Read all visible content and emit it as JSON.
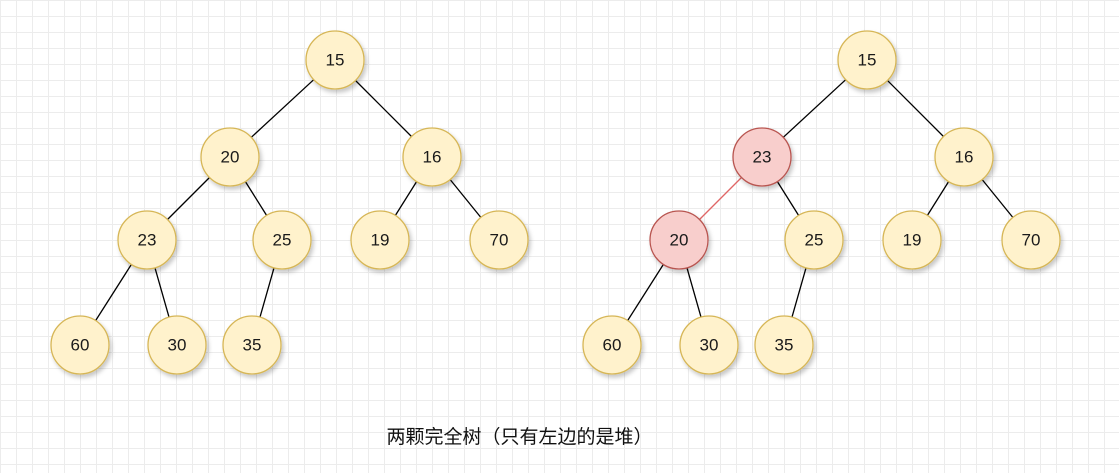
{
  "caption": "两颗完全树（只有左边的是堆）",
  "colors": {
    "node_fill": "#fff2cc",
    "node_stroke": "#d6b656",
    "highlight_fill": "#f8cecc",
    "highlight_stroke": "#b85450",
    "edge": "#000000",
    "highlight_edge": "#e06666"
  },
  "trees": [
    {
      "name": "left-tree",
      "nodes": [
        {
          "id": "n1",
          "label": "15"
        },
        {
          "id": "n2",
          "label": "20"
        },
        {
          "id": "n3",
          "label": "16"
        },
        {
          "id": "n4",
          "label": "23"
        },
        {
          "id": "n5",
          "label": "25"
        },
        {
          "id": "n6",
          "label": "19"
        },
        {
          "id": "n7",
          "label": "70"
        },
        {
          "id": "n8",
          "label": "60"
        },
        {
          "id": "n9",
          "label": "30"
        },
        {
          "id": "n10",
          "label": "35"
        }
      ],
      "edges": [
        [
          "n1",
          "n2"
        ],
        [
          "n1",
          "n3"
        ],
        [
          "n2",
          "n4"
        ],
        [
          "n2",
          "n5"
        ],
        [
          "n3",
          "n6"
        ],
        [
          "n3",
          "n7"
        ],
        [
          "n4",
          "n8"
        ],
        [
          "n4",
          "n9"
        ],
        [
          "n5",
          "n10"
        ]
      ]
    },
    {
      "name": "right-tree",
      "nodes": [
        {
          "id": "m1",
          "label": "15"
        },
        {
          "id": "m2",
          "label": "23",
          "highlight": true
        },
        {
          "id": "m3",
          "label": "16"
        },
        {
          "id": "m4",
          "label": "20",
          "highlight": true
        },
        {
          "id": "m5",
          "label": "25"
        },
        {
          "id": "m6",
          "label": "19"
        },
        {
          "id": "m7",
          "label": "70"
        },
        {
          "id": "m8",
          "label": "60"
        },
        {
          "id": "m9",
          "label": "30"
        },
        {
          "id": "m10",
          "label": "35"
        }
      ],
      "edges": [
        [
          "m1",
          "m2"
        ],
        [
          "m1",
          "m3"
        ],
        [
          "m2",
          "m4",
          "highlight"
        ],
        [
          "m2",
          "m5"
        ],
        [
          "m3",
          "m6"
        ],
        [
          "m3",
          "m7"
        ],
        [
          "m4",
          "m8"
        ],
        [
          "m4",
          "m9"
        ],
        [
          "m5",
          "m10"
        ]
      ]
    }
  ]
}
